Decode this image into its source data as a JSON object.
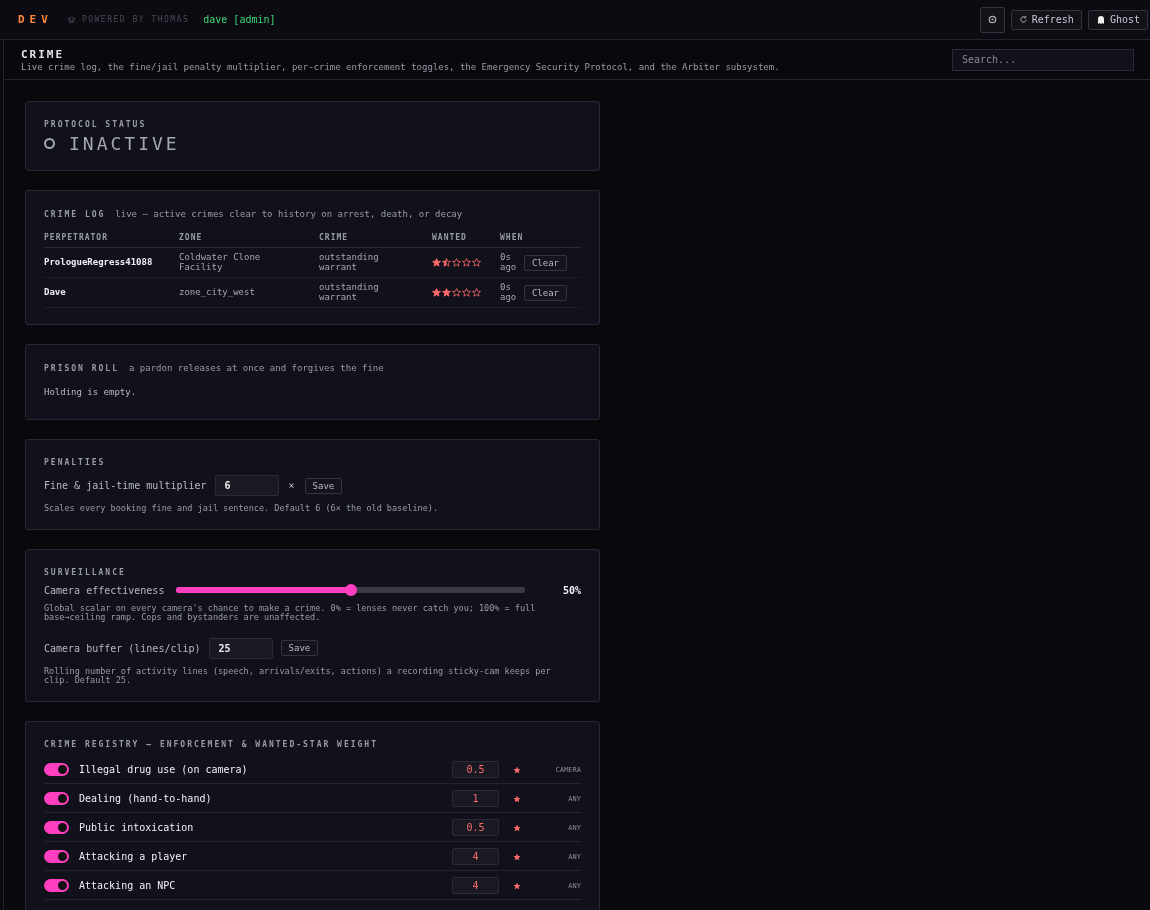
{
  "topbar": {
    "logo": "DEV",
    "powered_by": "POWERED BY THOMAS",
    "user": "dave [admin]",
    "buttons": [
      {
        "kind": "gear"
      },
      {
        "kind": "refresh",
        "label": "Refresh"
      },
      {
        "kind": "ghost",
        "label": "Ghost"
      }
    ]
  },
  "header": {
    "title": "CRIME",
    "subtitle": "Live crime log, the fine/jail penalty multiplier, per-crime enforcement toggles, the Emergency Security Protocol, and the Arbiter subsystem.",
    "search_placeholder": "Search..."
  },
  "protocol": {
    "title": "PROTOCOL STATUS",
    "active": false,
    "status": "INACTIVE"
  },
  "crime_log": {
    "title": "CRIME LOG",
    "note": "live — active crimes clear to history on arrest, death, or decay",
    "columns": [
      "PERPETRATOR",
      "ZONE",
      "CRIME",
      "WANTED",
      "WHEN"
    ],
    "rows": [
      {
        "perpetrator": "PrologueRegress41088",
        "zone": "Coldwater Clone Facility",
        "crime": "outstanding warrant",
        "stars": 1.5,
        "when": "0s ago",
        "action": "Clear"
      },
      {
        "perpetrator": "Dave",
        "zone": "zone_city_west",
        "crime": "outstanding warrant",
        "stars": 2,
        "when": "0s ago",
        "action": "Clear"
      }
    ]
  },
  "prison_roll": {
    "title": "PRISON ROLL",
    "note": "a pardon releases at once and forgives the fine",
    "empty": "Holding is empty."
  },
  "penalties": {
    "title": "PENALTIES",
    "label": "Fine & jail-time multiplier",
    "value": "6",
    "unit": "×",
    "button": "Save",
    "help": "Scales every booking fine and jail sentence. Default 6 (6× the old baseline)."
  },
  "surveillance": {
    "title": "SURVEILLANCE",
    "slider_label": "Camera effectiveness",
    "level": 0.5,
    "reading": "50%",
    "slider_help": "Global scalar on every camera's chance to make a crime. 0% = lenses never catch you; 100% = full base→ceiling ramp. Cops and bystanders are unaffected.",
    "buffer_label": "Camera buffer (lines/clip)",
    "buffer_value": "25",
    "button": "Save",
    "buffer_help": "Rolling number of activity lines (speech, arrivals/exits, actions) a recording sticky-cam keeps per clip. Default 25."
  },
  "registry": {
    "title": "CRIME REGISTRY — ENFORCEMENT & WANTED-STAR WEIGHT",
    "items": [
      {
        "name": "Illegal drug use (on camera)",
        "on": true,
        "weight": "0.5",
        "scope": "CAMERA"
      },
      {
        "name": "Dealing (hand-to-hand)",
        "on": true,
        "weight": "1",
        "scope": "ANY"
      },
      {
        "name": "Public intoxication",
        "on": true,
        "weight": "0.5",
        "scope": "ANY"
      },
      {
        "name": "Attacking a player",
        "on": true,
        "weight": "4",
        "scope": "ANY"
      },
      {
        "name": "Attacking an NPC",
        "on": true,
        "weight": "4",
        "scope": "ANY"
      }
    ]
  }
}
